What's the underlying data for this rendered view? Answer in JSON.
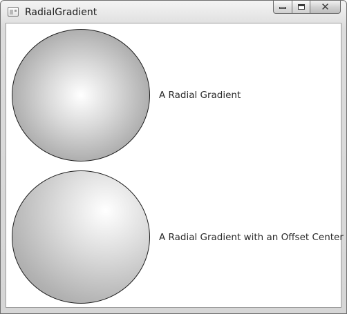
{
  "window": {
    "title": "RadialGradient",
    "icon": "window-app-icon",
    "caption_buttons": [
      "minimize-icon",
      "maximize-icon",
      "close-icon"
    ]
  },
  "content": {
    "items": [
      {
        "label": "A Radial Gradient",
        "gradient_center": "centered"
      },
      {
        "label": "A Radial Gradient with an Offset Center",
        "gradient_center": "offset"
      }
    ]
  },
  "colors": {
    "gradient_light": "#ffffff",
    "gradient_dark": "#8f8f8f",
    "ellipse_stroke": "#1e1e1e",
    "window_frame": "#d6d6d6"
  }
}
